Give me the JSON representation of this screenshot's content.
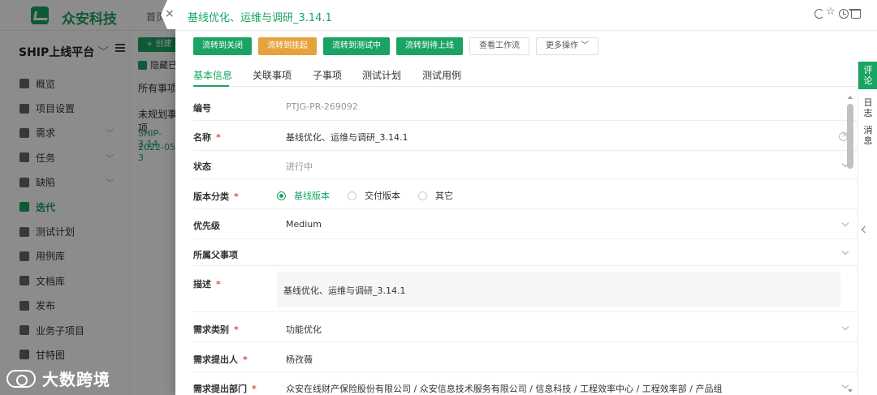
{
  "background": {
    "brand": "众安科技",
    "home_tab": "首页",
    "platform": "SHIP上线平台",
    "platform_chevron": "﹀",
    "nav": [
      {
        "label": "概览",
        "icon": "home-icon",
        "expandable": false,
        "active": false
      },
      {
        "label": "项目设置",
        "icon": "settings-icon",
        "expandable": false,
        "active": false
      },
      {
        "label": "需求",
        "icon": "bulb-icon",
        "expandable": true,
        "active": false
      },
      {
        "label": "任务",
        "icon": "task-icon",
        "expandable": true,
        "active": false
      },
      {
        "label": "缺陷",
        "icon": "bug-icon",
        "expandable": true,
        "active": false
      },
      {
        "label": "迭代",
        "icon": "iteration-icon",
        "expandable": false,
        "active": true
      },
      {
        "label": "测试计划",
        "icon": "test-plan-icon",
        "expandable": false,
        "active": false
      },
      {
        "label": "用例库",
        "icon": "case-library-icon",
        "expandable": false,
        "active": false
      },
      {
        "label": "文档库",
        "icon": "doc-library-icon",
        "expandable": false,
        "active": false
      },
      {
        "label": "发布",
        "icon": "release-icon",
        "expandable": false,
        "active": false
      },
      {
        "label": "业务子项目",
        "icon": "subproject-icon",
        "expandable": false,
        "active": false
      },
      {
        "label": "甘特图",
        "icon": "gantt-icon",
        "expandable": false,
        "active": false
      }
    ],
    "create_button": "+ 创建",
    "hide_checkbox": "隐藏已",
    "all_items": "所有事项",
    "unplanned": "未规划事项",
    "iteration_name_short": "SHIP-3.14",
    "iteration_date_short": "2022-05-3"
  },
  "watermark": "大数跨境",
  "drawer": {
    "title": "基线优化、运维与调研_3.14.1",
    "actions": [
      {
        "label": "流转到关闭",
        "style": "green"
      },
      {
        "label": "流转到挂起",
        "style": "orange"
      },
      {
        "label": "流转到测试中",
        "style": "green"
      },
      {
        "label": "流转到待上线",
        "style": "green"
      },
      {
        "label": "查看工作流",
        "style": "outline"
      },
      {
        "label": "更多操作 ﹀",
        "style": "outline"
      }
    ],
    "tabs": [
      {
        "label": "基本信息",
        "active": true
      },
      {
        "label": "关联事项",
        "active": false
      },
      {
        "label": "子事项",
        "active": false
      },
      {
        "label": "测试计划",
        "active": false
      },
      {
        "label": "测试用例",
        "active": false
      }
    ],
    "fields": {
      "number": {
        "label": "编号",
        "value": "PTJG-PR-269092"
      },
      "name": {
        "label": "名称",
        "required": "*",
        "value": "基线优化、运维与调研_3.14.1"
      },
      "status": {
        "label": "状态",
        "value": "进行中"
      },
      "version_type": {
        "label": "版本分类",
        "required": "*",
        "options": [
          "基线版本",
          "交付版本",
          "其它"
        ],
        "selected": "基线版本"
      },
      "priority": {
        "label": "优先级",
        "value": "Medium"
      },
      "parent": {
        "label": "所属父事项",
        "value": ""
      },
      "description": {
        "label": "描述",
        "required": "*",
        "value": "基线优化、运维与调研_3.14.1"
      },
      "req_type": {
        "label": "需求类别",
        "required": "*",
        "value": "功能优化"
      },
      "proposer": {
        "label": "需求提出人",
        "required": "*",
        "value": "杨孜薇"
      },
      "dept": {
        "label": "需求提出部门",
        "required": "*",
        "value": "众安在线财产保险股份有限公司 / 众安信息技术服务有限公司 / 信息科技 / 工程效率中心 / 工程效率部 / 产品组"
      }
    },
    "side_tabs": [
      {
        "label": "评\n论",
        "active": true
      },
      {
        "label": "日\n志",
        "active": false
      },
      {
        "label": "消\n息",
        "active": false
      }
    ]
  },
  "colors": {
    "accent": "#1aa363",
    "warning": "#e6a23c",
    "required": "#e74c3c"
  }
}
